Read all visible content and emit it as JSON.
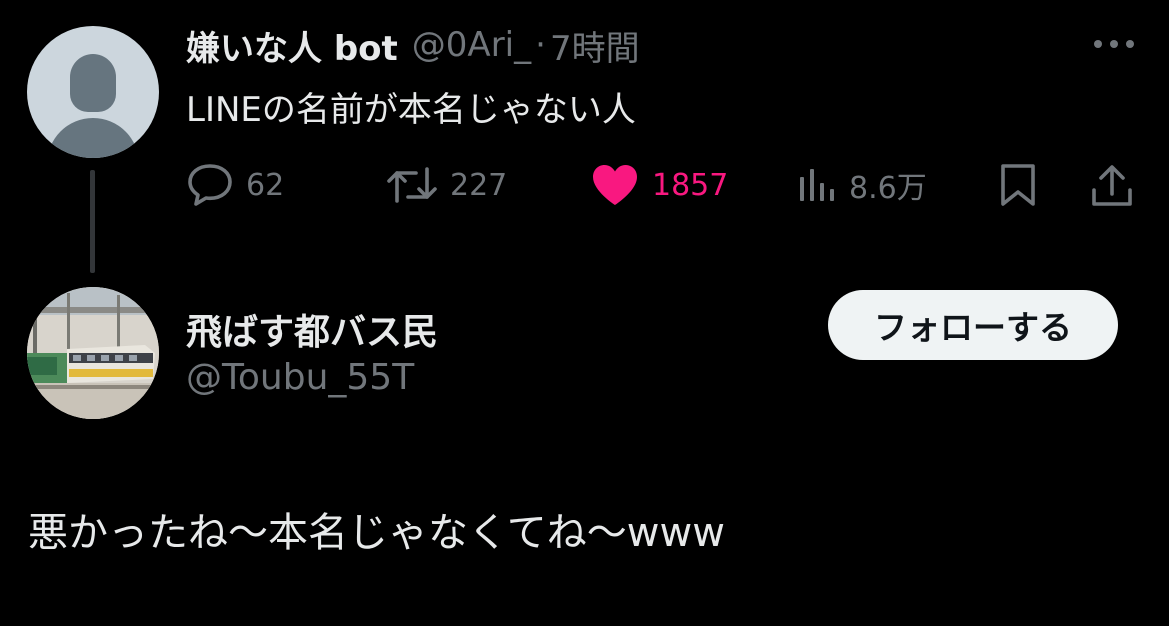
{
  "parent_tweet": {
    "display_name": "嫌いな人 bot",
    "handle": "@0Ari_",
    "separator": "·",
    "time": "7時間",
    "text": "LINEの名前が本名じゃない人",
    "actions": {
      "reply_count": "62",
      "retweet_count": "227",
      "like_count": "1857",
      "views_count": "8.6万"
    },
    "more_icon": "more-horizontal-icon",
    "liked": true
  },
  "reply_tweet": {
    "display_name": "飛ばす都バス民",
    "handle": "@Toubu_55T",
    "follow_label": "フォローする",
    "text": "悪かったね〜本名じゃなくてね〜www"
  },
  "colors": {
    "background": "#000000",
    "primary_text": "#e7e9ea",
    "secondary_text": "#71767b",
    "like_active": "#f91880",
    "follow_button_bg": "#eff3f4",
    "follow_button_text": "#0f1419",
    "thread_line": "#333639"
  },
  "icons": {
    "reply": "reply-bubble-icon",
    "retweet": "retweet-icon",
    "like": "heart-filled-icon",
    "views": "analytics-bars-icon",
    "bookmark": "bookmark-icon",
    "share": "share-upload-icon"
  }
}
